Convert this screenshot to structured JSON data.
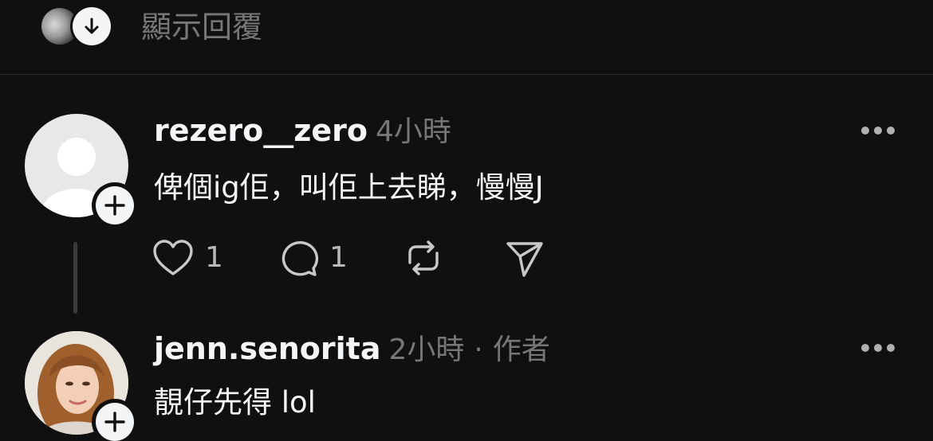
{
  "top": {
    "show_replies": "顯示回覆"
  },
  "comments": [
    {
      "username": "rezero__zero",
      "time": "4小時",
      "text": "俾個ig佢，叫佢上去睇，慢慢J",
      "likes": "1",
      "replies": "1"
    },
    {
      "username": "jenn.senorita",
      "time": "2小時",
      "separator": "·",
      "author_tag": "作者",
      "text": "靚仔先得 lol"
    }
  ],
  "icons": [
    "arrow-down-icon",
    "plus-icon",
    "heart-icon",
    "comment-icon",
    "repost-icon",
    "send-icon",
    "more-icon"
  ]
}
